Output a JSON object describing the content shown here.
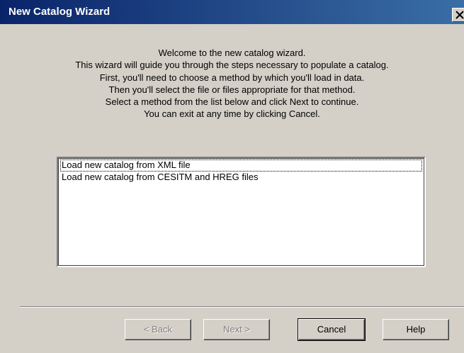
{
  "window": {
    "title": "New Catalog Wizard",
    "close_glyph": "✕"
  },
  "intro": {
    "lines": [
      "Welcome to the new catalog wizard.",
      "This wizard will guide you through the steps necessary to populate a catalog.",
      "First, you'll need to choose a method by which you'll load in data.",
      "Then you'll select the file or files appropriate for that method.",
      "Select a method from the list below and click Next to continue.",
      "You can exit at any time by clicking Cancel."
    ]
  },
  "methods": {
    "items": [
      "Load new catalog from XML file",
      "Load new catalog from CESITM and HREG files"
    ],
    "focused_index": 0
  },
  "buttons": {
    "back": "< Back",
    "next": "Next >",
    "cancel": "Cancel",
    "help": "Help"
  },
  "colors": {
    "titlebar_start": "#0a246a",
    "titlebar_end": "#3a6ea5",
    "dialog_face": "#d4d0c8"
  }
}
